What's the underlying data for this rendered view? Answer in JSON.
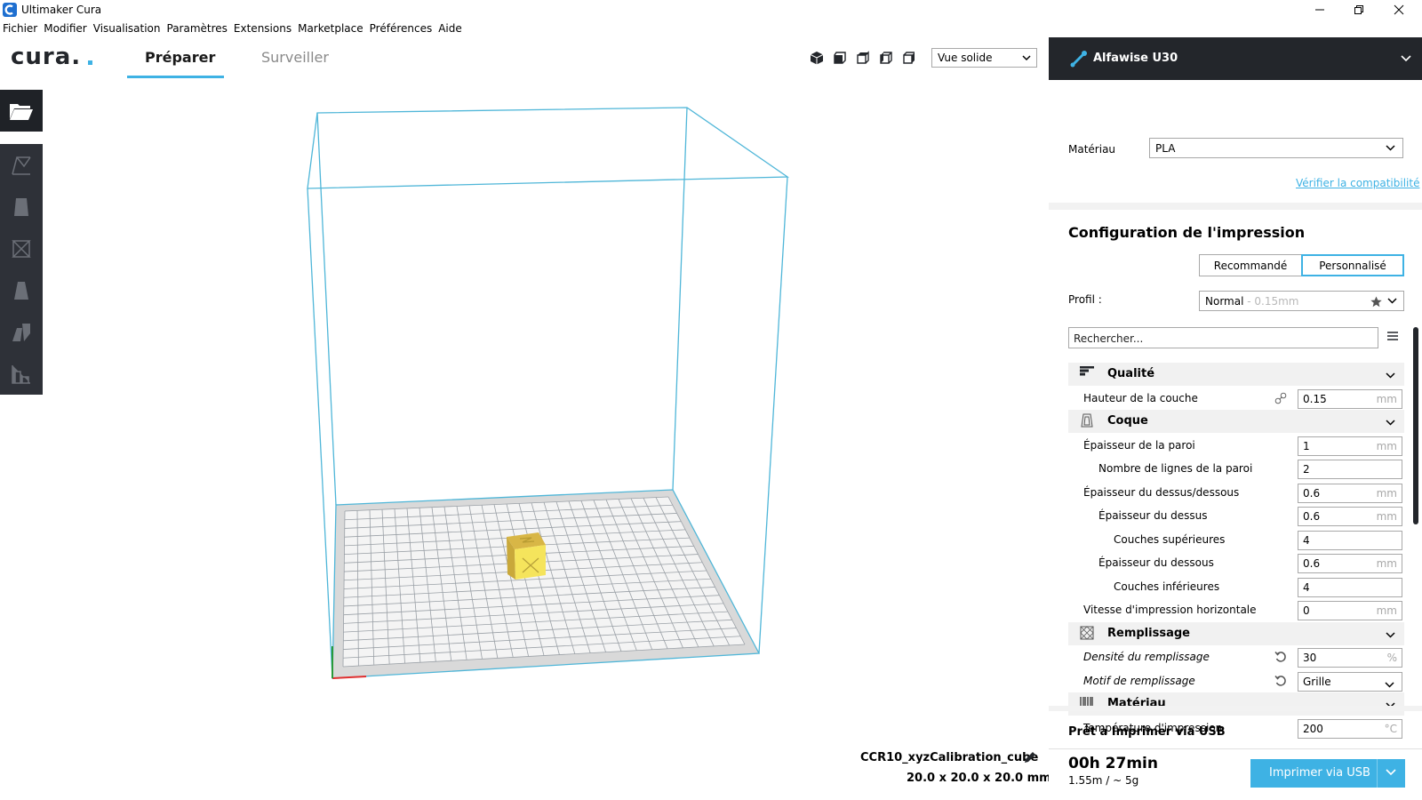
{
  "window": {
    "title": "Ultimaker Cura"
  },
  "menu": [
    "Fichier",
    "Modifier",
    "Visualisation",
    "Paramètres",
    "Extensions",
    "Marketplace",
    "Préférences",
    "Aide"
  ],
  "header": {
    "logo": "cura.",
    "tabs": [
      {
        "label": "Préparer",
        "active": true
      },
      {
        "label": "Surveiller",
        "active": false
      }
    ],
    "view_mode": "Vue solide"
  },
  "model": {
    "name": "CCR10_xyzCalibration_cube",
    "dimensions": "20.0 x 20.0 x 20.0 mm"
  },
  "printer": {
    "name": "Alfawise U30"
  },
  "material": {
    "label": "Matériau",
    "value": "PLA",
    "compat_link": "Vérifier la compatibilité"
  },
  "config": {
    "title": "Configuration de l'impression",
    "modes": {
      "recommended": "Recommandé",
      "custom": "Personnalisé"
    },
    "profile": {
      "label": "Profil :",
      "value": "Normal",
      "detail": " - 0.15mm"
    },
    "search_placeholder": "Rechercher..."
  },
  "settings": [
    {
      "type": "category",
      "label": "Qualité",
      "icon": "quality-icon"
    },
    {
      "type": "setting",
      "label": "Hauteur de la couche",
      "value": "0.15",
      "unit": "mm",
      "indent": 0,
      "link": true
    },
    {
      "type": "category",
      "label": "Coque",
      "icon": "shell-icon"
    },
    {
      "type": "setting",
      "label": "Épaisseur de la paroi",
      "value": "1",
      "unit": "mm",
      "indent": 0
    },
    {
      "type": "setting",
      "label": "Nombre de lignes de la paroi",
      "value": "2",
      "unit": "",
      "indent": 1
    },
    {
      "type": "setting",
      "label": "Épaisseur du dessus/dessous",
      "value": "0.6",
      "unit": "mm",
      "indent": 0
    },
    {
      "type": "setting",
      "label": "Épaisseur du dessus",
      "value": "0.6",
      "unit": "mm",
      "indent": 1
    },
    {
      "type": "setting",
      "label": "Couches supérieures",
      "value": "4",
      "unit": "",
      "indent": 2
    },
    {
      "type": "setting",
      "label": "Épaisseur du dessous",
      "value": "0.6",
      "unit": "mm",
      "indent": 1
    },
    {
      "type": "setting",
      "label": "Couches inférieures",
      "value": "4",
      "unit": "",
      "indent": 2
    },
    {
      "type": "setting",
      "label": "Vitesse d'impression horizontale",
      "value": "0",
      "unit": "mm",
      "indent": 0
    },
    {
      "type": "category",
      "label": "Remplissage",
      "icon": "infill-icon"
    },
    {
      "type": "setting",
      "label": "Densité du remplissage",
      "value": "30",
      "unit": "%",
      "indent": 0,
      "italic": true,
      "reset": true
    },
    {
      "type": "setting",
      "label": "Motif de remplissage",
      "value": "Grille",
      "unit": "",
      "indent": 0,
      "italic": true,
      "reset": true,
      "dropdown": true
    },
    {
      "type": "category",
      "label": "Matériau",
      "icon": "material-icon"
    },
    {
      "type": "setting",
      "label": "Température d'impression",
      "value": "200",
      "unit": "°C",
      "indent": 0
    }
  ],
  "footer": {
    "status": "Prêt à Imprimer via USB",
    "time": "00h 27min",
    "usage": "1.55m / ~ 5g",
    "print_button": "Imprimer via USB"
  },
  "colors": {
    "accent": "#3eb2e4",
    "dark": "#23262b",
    "model": "#f5e45c"
  }
}
